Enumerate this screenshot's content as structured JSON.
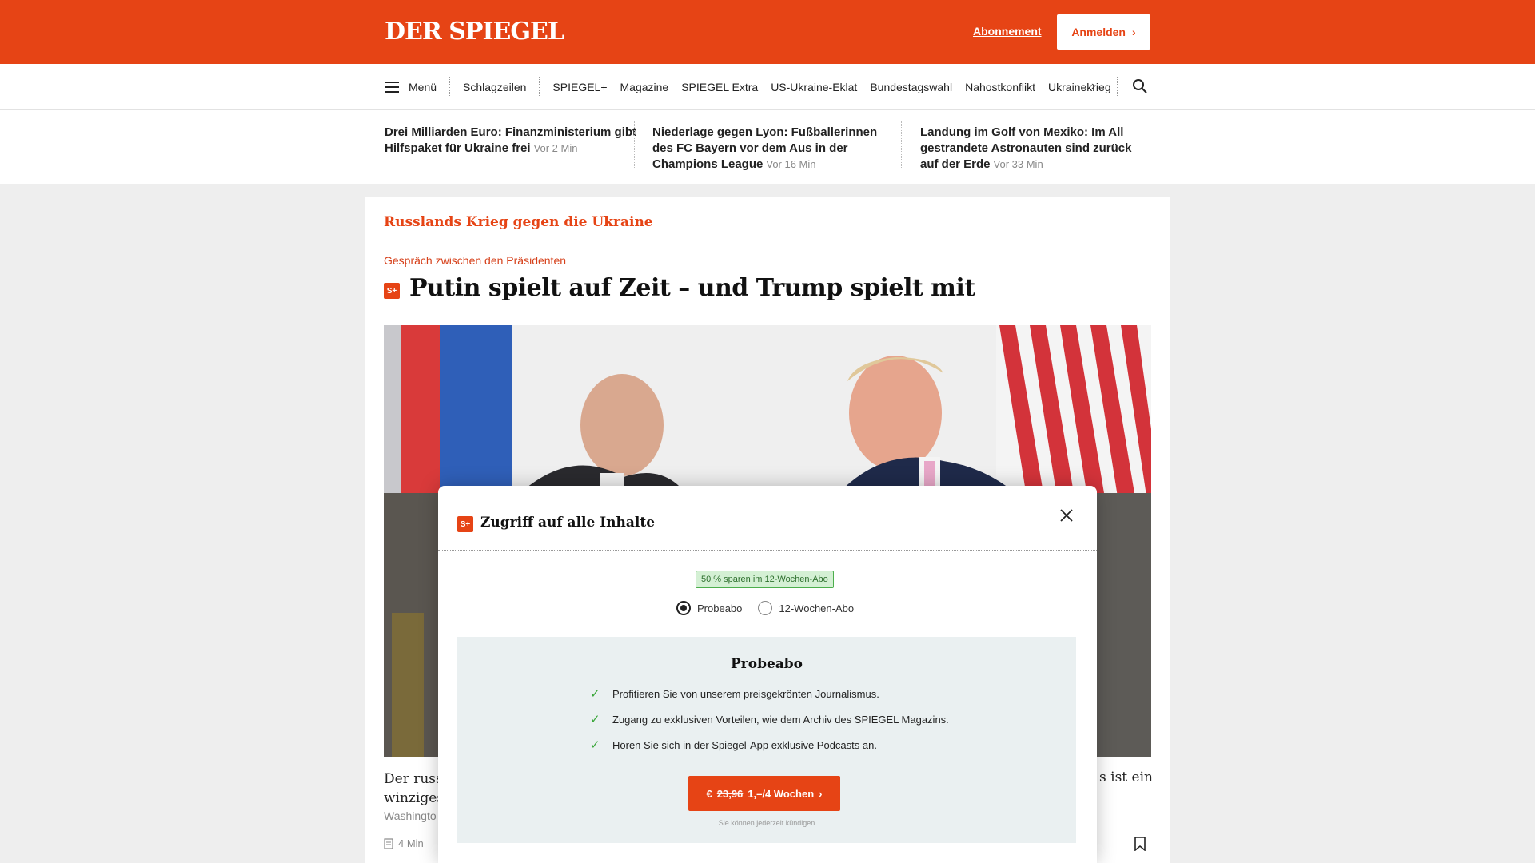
{
  "header": {
    "logo": "DER SPIEGEL",
    "subscription_link": "Abonnement",
    "login_button": "Anmelden",
    "brand_color": "#e64415"
  },
  "nav": {
    "menu_label": "Menü",
    "items": [
      "Schlagzeilen",
      "SPIEGEL+",
      "Magazine",
      "SPIEGEL Extra",
      "US-Ukraine-Eklat",
      "Bundestagswahl",
      "Nahostkonflikt",
      "Ukrainekrieg"
    ],
    "more_icon": "chevron-right-icon",
    "search_icon": "search-icon"
  },
  "ticker": [
    {
      "title": "Drei Milliarden Euro: Finanzministerium gibt Hilfspaket für Ukraine frei",
      "time": "Vor 2 Min"
    },
    {
      "title": "Niederlage gegen Lyon: Fußballerinnen des FC Bayern vor dem Aus in der Champions League",
      "time": "Vor 16 Min"
    },
    {
      "title": "Landung im Golf von Mexiko: Im All gestrandete Astronauten sind zurück auf der Erde",
      "time": "Vor 33 Min"
    }
  ],
  "article": {
    "kicker": "Russlands Krieg gegen die Ukraine",
    "subkicker": "Gespräch zwischen den Präsidenten",
    "badge": "S+",
    "headline": "Putin spielt auf Zeit – und Trump spielt mit",
    "teaser_left_1": "Der russi",
    "teaser_left_2": "winziges",
    "teaser_right": "s ist ein",
    "meta": "Washingto",
    "readtime": "4 Min"
  },
  "modal": {
    "badge": "S+",
    "title": "Zugriff auf alle Inhalte",
    "save_badge": "50 % sparen im 12-Wochen-Abo",
    "options": [
      {
        "label": "Probeabo",
        "selected": true
      },
      {
        "label": "12-Wochen-Abo",
        "selected": false
      }
    ],
    "offer_title": "Probeabo",
    "benefits": [
      "Profitieren Sie von unserem preisgekrönten Journalismus.",
      "Zugang zu exklusiven Vorteilen, wie dem Archiv des SPIEGEL Magazins.",
      "Hören Sie sich in der Spiegel-App exklusive Podcasts an."
    ],
    "cta_prefix": "€",
    "cta_old_price": "23,96",
    "cta_price": "1,–/4 Wochen",
    "cancel_note": "Sie können jederzeit kündigen"
  }
}
